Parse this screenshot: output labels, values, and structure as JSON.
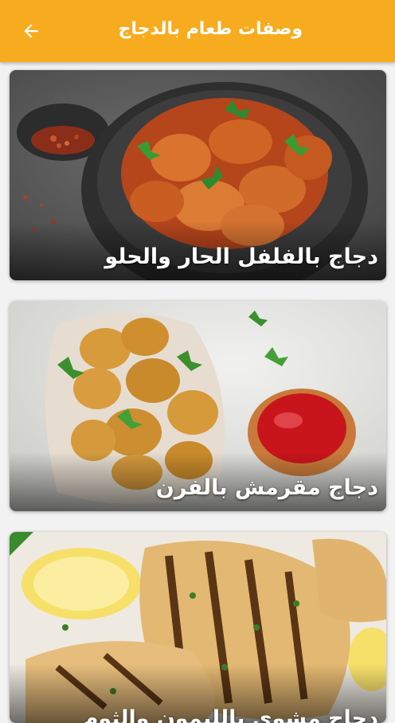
{
  "appbar": {
    "title": "وصفات طعام بالدجاج",
    "back_icon": "arrow-back-icon",
    "color": "#f7ac1f"
  },
  "recipes": [
    {
      "title": "دجاج بالفلفل الحار والحلو",
      "image": "sweet-chili-chicken-photo"
    },
    {
      "title": "دجاج مقرمش بالفرن",
      "image": "crispy-baked-chicken-photo"
    },
    {
      "title": "دجاج مشوي بالليمون والثوم",
      "image": "grilled-lemon-garlic-chicken-photo"
    }
  ]
}
